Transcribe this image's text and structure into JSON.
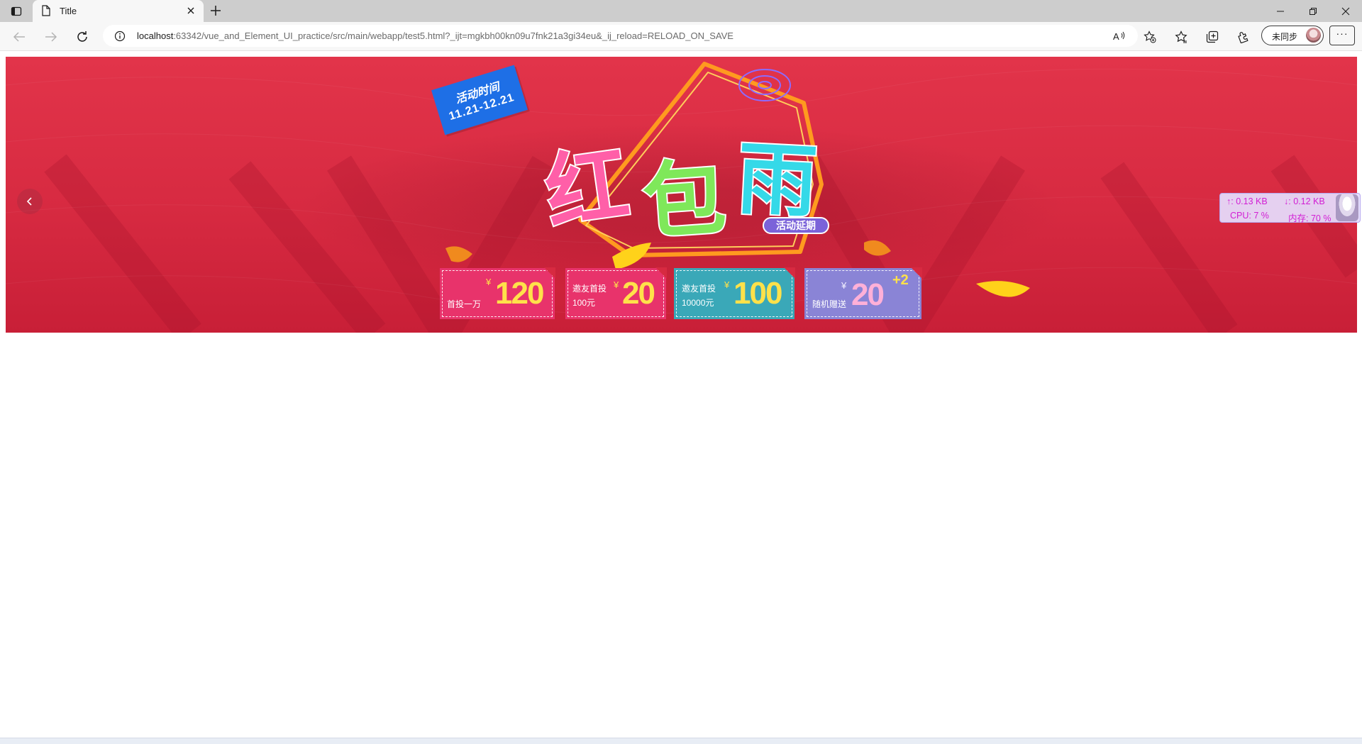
{
  "browser": {
    "tab": {
      "title": "Title"
    },
    "address": {
      "host": "localhost",
      "path": ":63342/vue_and_Element_UI_practice/src/main/webapp/test5.html?_ijt=mgkbh00kn09u7fnk21a3gi34eu&_ij_reload=RELOAD_ON_SAVE"
    },
    "profile": {
      "label": "未同步"
    },
    "more_label": "···"
  },
  "banner": {
    "date_tag": {
      "line1": "活动时间",
      "line2": "11.21-12.21"
    },
    "title_chars": [
      "红",
      "包",
      "雨"
    ],
    "badge": "活动延期",
    "coupons": [
      {
        "desc_line1": "",
        "desc_line2": "首投一万",
        "currency": "¥",
        "amount": "120",
        "extra": ""
      },
      {
        "desc_line1": "邀友首投",
        "desc_line2": "100元",
        "currency": "¥",
        "amount": "20",
        "extra": ""
      },
      {
        "desc_line1": "邀友首投",
        "desc_line2": "10000元",
        "currency": "¥",
        "amount": "100",
        "extra": ""
      },
      {
        "desc_line1": "",
        "desc_line2": "随机赠送",
        "currency": "¥",
        "amount": "20",
        "extra": "+2"
      }
    ],
    "colors": {
      "background": "#d72a41",
      "date_tag": "#1e6fe6",
      "coupon_pink": "#e8336b",
      "coupon_teal": "#3aa8b8",
      "coupon_purple": "#8a84d6",
      "amount": "#ffe14a"
    }
  },
  "netmon": {
    "upload": "↑: 0.13 KB",
    "download": "↓: 0.12 KB",
    "cpu": "CPU: 7 %",
    "memory": "内存: 70 %"
  }
}
